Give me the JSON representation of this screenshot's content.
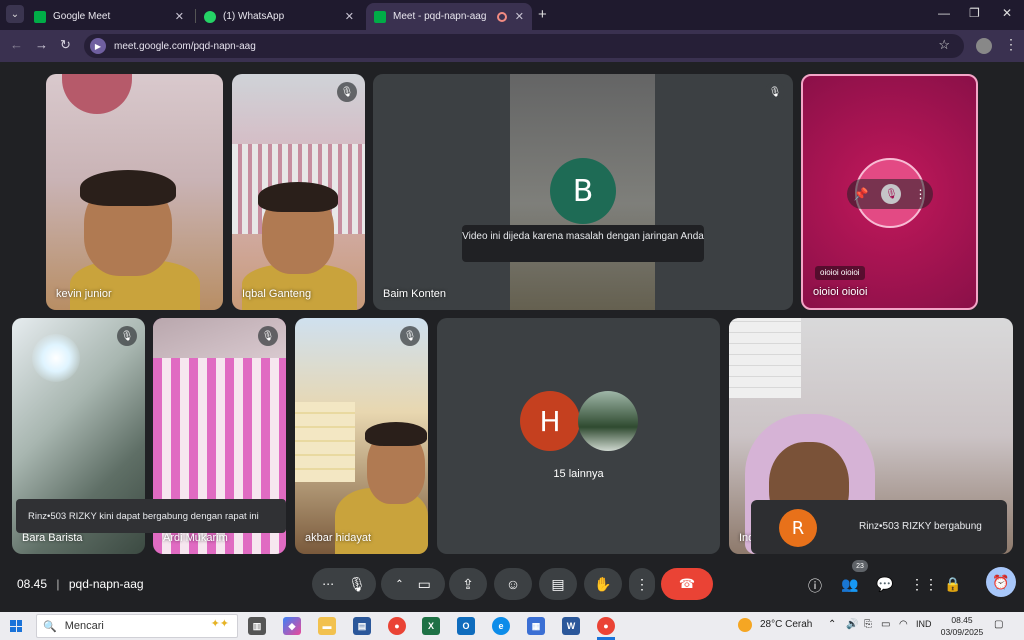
{
  "browser": {
    "tabs": [
      {
        "title": "Google Meet",
        "icon": "meet-icon",
        "active": false
      },
      {
        "title": "(1) WhatsApp",
        "icon": "whatsapp-icon",
        "active": false
      },
      {
        "title": "Meet - pqd-napn-aag",
        "icon": "meet-icon",
        "active": true
      }
    ],
    "url": "meet.google.com/pqd-napn-aag"
  },
  "meet": {
    "tiles": {
      "kevin": {
        "name": "kevin junior"
      },
      "iqbal": {
        "name": "Iqbal Ganteng"
      },
      "baim": {
        "name": "Baim Konten",
        "avatar_letter": "B",
        "notice": "Video ini dijeda karena masalah dengan jaringan Anda"
      },
      "oioi": {
        "name": "oioioi oioioi",
        "label_chip": "oioioi oioioi"
      },
      "bara": {
        "name": "Bara Barista"
      },
      "ardi": {
        "name": "Ardi Mukarim"
      },
      "akbar": {
        "name": "akbar hidayat"
      },
      "others": {
        "avatar_letter": "H",
        "label": "15 lainnya"
      },
      "ind": {
        "name": "Ind"
      }
    },
    "toast_left": "Rinz•503 RIZKY kini dapat bergabung dengan rapat ini",
    "toast_right": {
      "avatar_letter": "R",
      "text": "Rinz•503 RIZKY bergabung"
    },
    "bottom": {
      "time": "08.45",
      "separator": "|",
      "meeting_code": "pqd-napn-aag",
      "participant_count": "23"
    },
    "colors": {
      "end_call": "#ea4335",
      "avatar_b": "#1e6b55",
      "avatar_h": "#c5401f",
      "avatar_r": "#e8711a",
      "highlight_tile": "#a8195c"
    }
  },
  "taskbar": {
    "search_placeholder": "Mencari",
    "weather": "28°C  Cerah",
    "lang": "IND",
    "time": "08.45",
    "date": "03/09/2025"
  }
}
